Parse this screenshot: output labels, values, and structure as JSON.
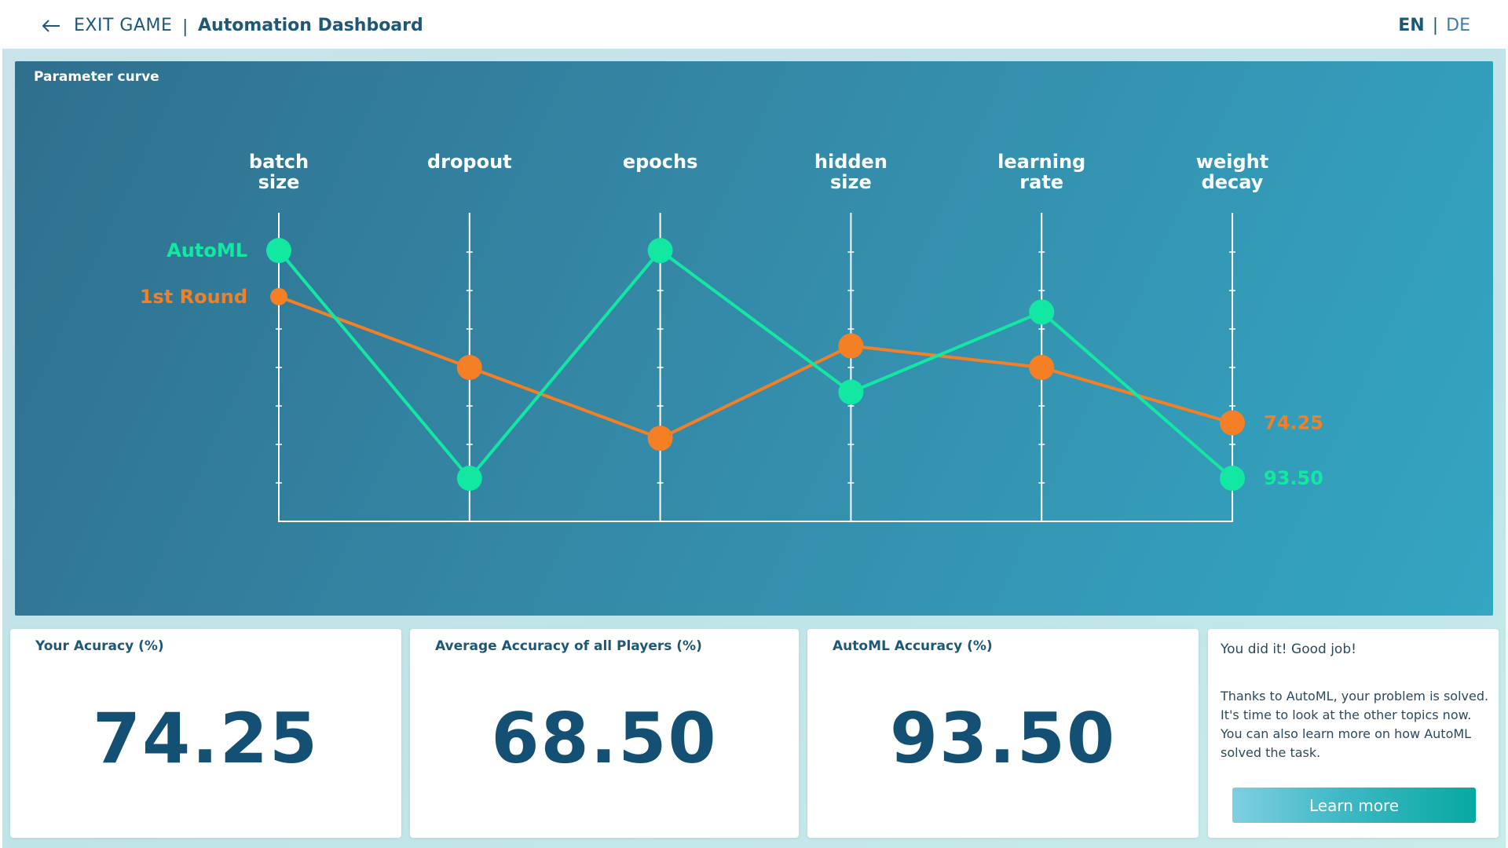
{
  "header": {
    "exit_label": "EXIT GAME",
    "separator": "|",
    "title": "Automation Dashboard",
    "lang_en": "EN",
    "lang_separator": "|",
    "lang_de": "DE",
    "back_icon": "arrow-left-icon"
  },
  "chart": {
    "panel_title": "Parameter curve"
  },
  "chart_data": {
    "type": "line",
    "title": "Parameter curve",
    "categories": [
      [
        "batch",
        "size"
      ],
      [
        "dropout"
      ],
      [
        "epochs"
      ],
      [
        "hidden",
        "size"
      ],
      [
        "learning",
        "rate"
      ],
      [
        "weight",
        "decay"
      ]
    ],
    "ylim": [
      0,
      1
    ],
    "grid": false,
    "series": [
      {
        "name": "AutoML",
        "color": "#13e8a2",
        "values": [
          0.88,
          0.14,
          0.88,
          0.42,
          0.68,
          0.14
        ],
        "end_label": "93.50"
      },
      {
        "name": "1st Round",
        "color": "#f47f25",
        "values": [
          0.73,
          0.5,
          0.27,
          0.57,
          0.5,
          0.32
        ],
        "end_label": "74.25"
      }
    ]
  },
  "cards": [
    {
      "title": "Your Acuracy (%)",
      "value": "74.25"
    },
    {
      "title": "Average Accuracy of all Players (%)",
      "value": "68.50"
    },
    {
      "title": "AutoML Accuracy (%)",
      "value": "93.50"
    }
  ],
  "message": {
    "headline": "You did it! Good job!",
    "body": "Thanks to AutoML, your problem is solved. It's time to look at the other topics now. You can also learn more on how AutoML solved the task.",
    "button_label": "Learn more"
  }
}
